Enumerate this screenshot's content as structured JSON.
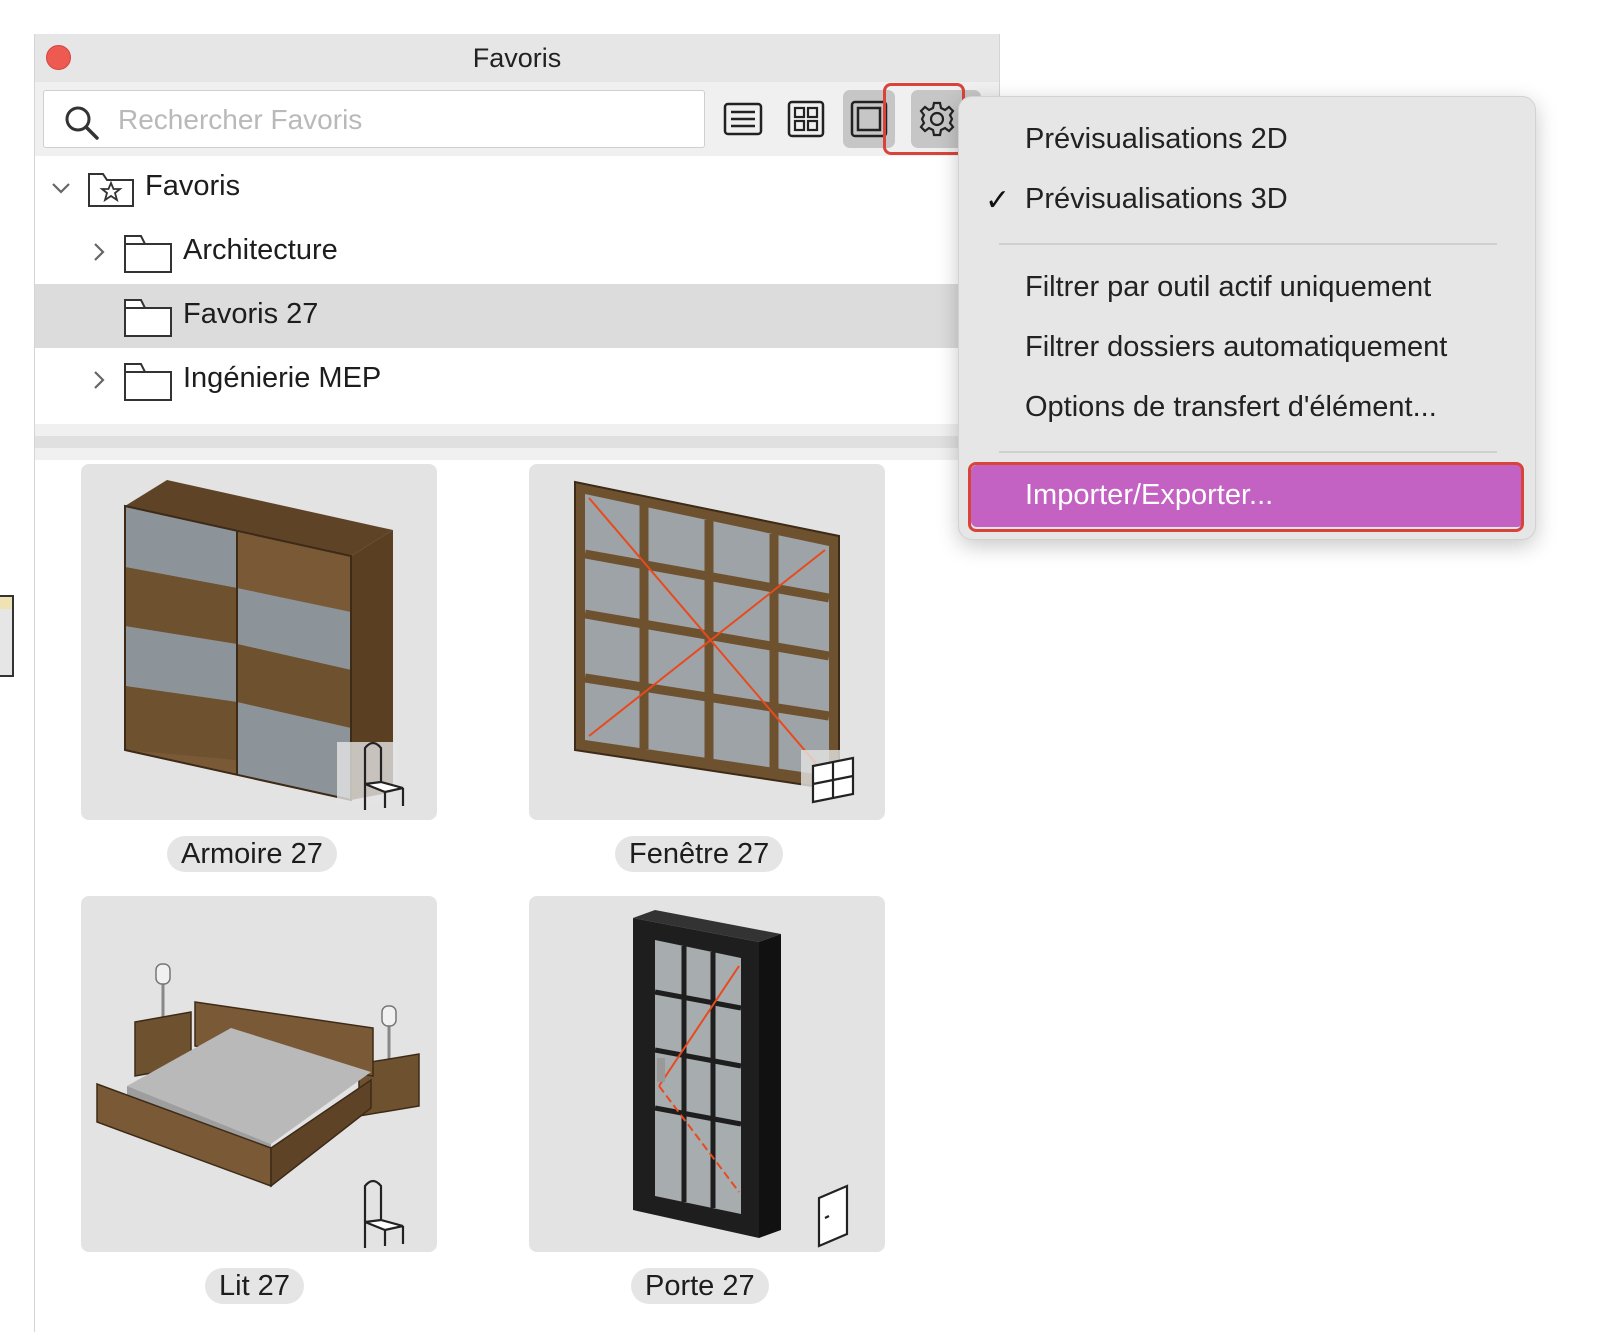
{
  "window": {
    "title": "Favoris"
  },
  "search": {
    "placeholder": "Rechercher Favoris",
    "value": ""
  },
  "toolbar": {
    "list_view": "list-view-icon",
    "grid_view": "grid-view-icon",
    "large_preview": "large-preview-icon",
    "settings": "gear-icon"
  },
  "tree": {
    "items": [
      {
        "label": "Favoris",
        "expanded": true,
        "icon": "favorites-folder-icon"
      },
      {
        "label": "Architecture",
        "expanded": false,
        "icon": "folder-icon"
      },
      {
        "label": "Favoris 27",
        "selected": true,
        "icon": "folder-icon"
      },
      {
        "label": "Ingénierie MEP",
        "expanded": false,
        "icon": "folder-icon"
      }
    ]
  },
  "favorites": [
    {
      "label": "Armoire 27",
      "type_icon": "chair-icon"
    },
    {
      "label": "Fenêtre 27",
      "type_icon": "window-icon"
    },
    {
      "label": "Lit 27",
      "type_icon": "chair-icon"
    },
    {
      "label": "Porte 27",
      "type_icon": "door-icon"
    }
  ],
  "menu": {
    "items": [
      {
        "label": "Prévisualisations 2D",
        "checked": false
      },
      {
        "label": "Prévisualisations 3D",
        "checked": true
      },
      {
        "label": "Filtrer par outil actif uniquement"
      },
      {
        "label": "Filtrer dossiers automatiquement"
      },
      {
        "label": "Options de transfert d'élément..."
      },
      {
        "label": "Importer/Exporter...",
        "highlighted": true
      }
    ],
    "checkmark": "✓"
  },
  "colors": {
    "highlight": "#c362c2",
    "annotation_border": "#d9443a",
    "close_button": "#ee5a52"
  }
}
